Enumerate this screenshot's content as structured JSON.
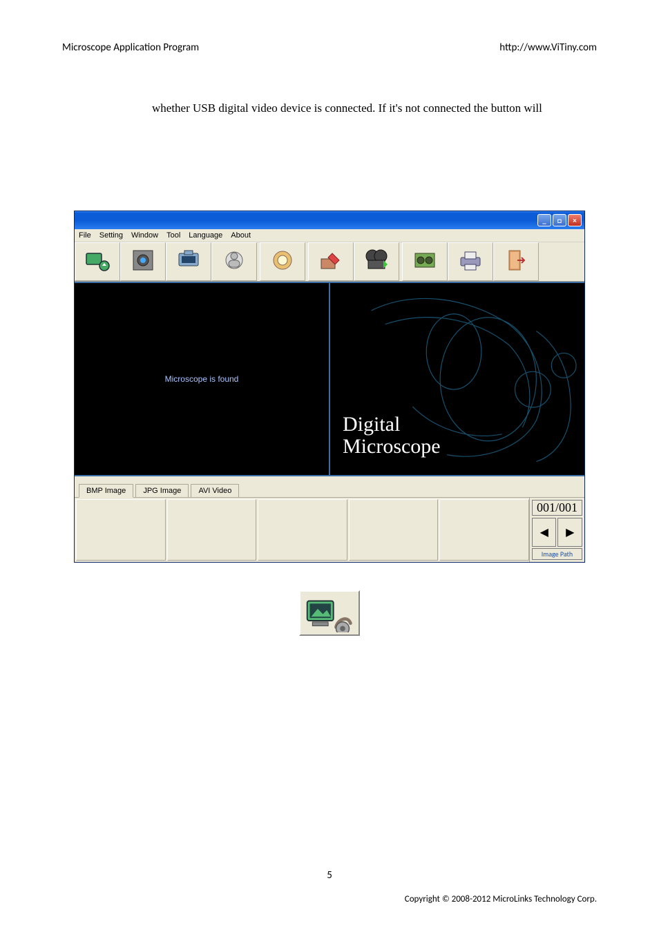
{
  "header": {
    "left": "Microscope Application Program",
    "right": "http://www.ViTiny.com"
  },
  "body_paragraph": "whether USB digital video device is connected. If it's not connected the button will",
  "window": {
    "menubar": [
      "File",
      "Setting",
      "Window",
      "Tool",
      "Language",
      "About"
    ],
    "toolbar_icons": [
      "connect-icon",
      "device-icon",
      "snapshot-icon",
      "save-icon",
      "open-icon",
      "edit-icon",
      "video-icon",
      "recorder-icon",
      "print-icon",
      "exit-icon"
    ],
    "left_preview_text": "Microscope is found",
    "splash_line1": "Digital",
    "splash_line2": "Microscope",
    "tabs": [
      "BMP Image",
      "JPG Image",
      "AVI Video"
    ],
    "page_counter": "001/001",
    "nav_prev": "◀",
    "nav_next": "▶",
    "image_path_label": "Image Path"
  },
  "page_number": "5",
  "copyright": "Copyright © 2008-2012 MicroLinks Technology Corp."
}
